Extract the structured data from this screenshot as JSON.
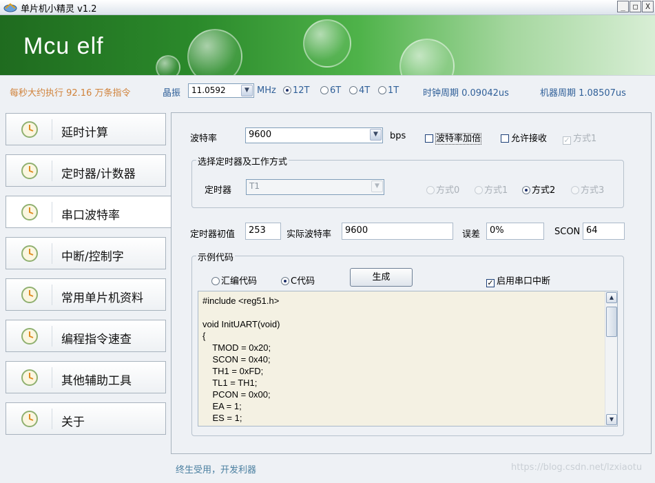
{
  "window": {
    "title": "单片机小精灵 v1.2",
    "controls": [
      "_",
      "□",
      "X"
    ]
  },
  "banner": {
    "logo": "Mcu elf"
  },
  "infobar": {
    "speed": "每秒大约执行 92.16 万条指令",
    "crystal_label": "晶振",
    "crystal_value": "11.0592",
    "crystal_unit": "MHz",
    "modes": [
      "12T",
      "6T",
      "4T",
      "1T"
    ],
    "selected_mode": "12T",
    "clock_period": "时钟周期 0.09042us",
    "machine_period": "机器周期 1.08507us"
  },
  "sidebar": {
    "items": [
      {
        "label": "延时计算",
        "active": false
      },
      {
        "label": "定时器/计数器",
        "active": false
      },
      {
        "label": "串口波特率",
        "active": true
      },
      {
        "label": "中断/控制字",
        "active": false
      },
      {
        "label": "常用单片机资料",
        "active": false
      },
      {
        "label": "编程指令速查",
        "active": false
      },
      {
        "label": "其他辅助工具",
        "active": false
      },
      {
        "label": "关于",
        "active": false
      }
    ]
  },
  "main": {
    "baud_label": "波特率",
    "baud_value": "9600",
    "baud_unit": "bps",
    "double_baud": "波特率加倍",
    "allow_receive": "允许接收",
    "mode1_check": "方式1",
    "timer_group_title": "选择定时器及工作方式",
    "timer_label": "定时器",
    "timer_value": "T1",
    "timer_modes": [
      "方式0",
      "方式1",
      "方式2",
      "方式3"
    ],
    "selected_timer_mode": "方式2",
    "init_label": "定时器初值",
    "init_value": "253",
    "actual_baud_label": "实际波特率",
    "actual_baud_value": "9600",
    "error_label": "误差",
    "error_value": "0%",
    "scon_label": "SCON",
    "scon_value": "64",
    "code_group_title": "示例代码",
    "code_asm": "汇编代码",
    "code_c": "C代码",
    "selected_code": "C代码",
    "generate_btn": "生成",
    "enable_interrupt": "启用串口中断",
    "enable_interrupt_checked": true,
    "code_lines": [
      "#include <reg51.h>",
      "",
      "void InitUART(void)",
      "{",
      "    TMOD = 0x20;",
      "    SCON = 0x40;",
      "    TH1 = 0xFD;",
      "    TL1 = TH1;",
      "    PCON = 0x00;",
      "    EA = 1;",
      "    ES = 1;"
    ]
  },
  "footer": {
    "slogan": "终生受用，开发利器",
    "watermark": "https://blog.csdn.net/lzxiaotu"
  },
  "colors": {
    "accent_orange": "#d0823a",
    "accent_blue": "#2f5f98",
    "banner_green": "#2b8a2b"
  }
}
